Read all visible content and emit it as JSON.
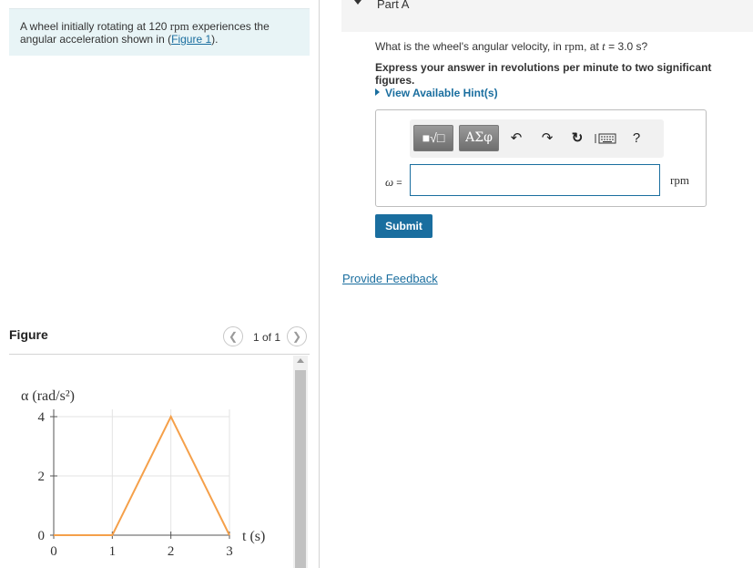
{
  "problem": {
    "text_before": "A wheel initially rotating at 120 ",
    "rpm": "rpm",
    "text_after": " experiences the angular acceleration shown in (",
    "figure_link": "Figure 1",
    "text_end": ")."
  },
  "figure": {
    "title": "Figure",
    "pager": "1 of 1",
    "prev_icon": "chevron-left-icon",
    "next_icon": "chevron-right-icon"
  },
  "part_a": {
    "label": "Part A",
    "question_before": "What is the wheel's angular velocity, in ",
    "question_unit": "rpm",
    "question_mid": ", at ",
    "question_t": "t",
    "question_after": " = 3.0 s?",
    "instruction": "Express your answer in revolutions per minute to two significant figures.",
    "hint": "View Available Hint(s)",
    "toolbar": {
      "template_button": "■√□",
      "greek_button": "ΑΣφ",
      "help": "?"
    },
    "omega_label": "ω",
    "equals": " =",
    "input_value": "",
    "unit": "rpm",
    "submit": "Submit",
    "feedback": "Provide Feedback"
  },
  "colors": {
    "accent": "#1a6e9f",
    "line": "#f5a04a",
    "grid": "#e3e3e3",
    "problem_bg": "#e8f4f6"
  },
  "chart_data": {
    "type": "line",
    "ylabel": "α (rad/s²)",
    "xlabel": "t (s)",
    "x": [
      0,
      1,
      2,
      3
    ],
    "y": [
      0,
      0,
      4,
      0
    ],
    "x_ticks": [
      "0",
      "1",
      "2",
      "3"
    ],
    "y_ticks": [
      "0",
      "2",
      "4"
    ],
    "xlim": [
      0,
      3
    ],
    "ylim": [
      0,
      4
    ],
    "grid": true
  }
}
